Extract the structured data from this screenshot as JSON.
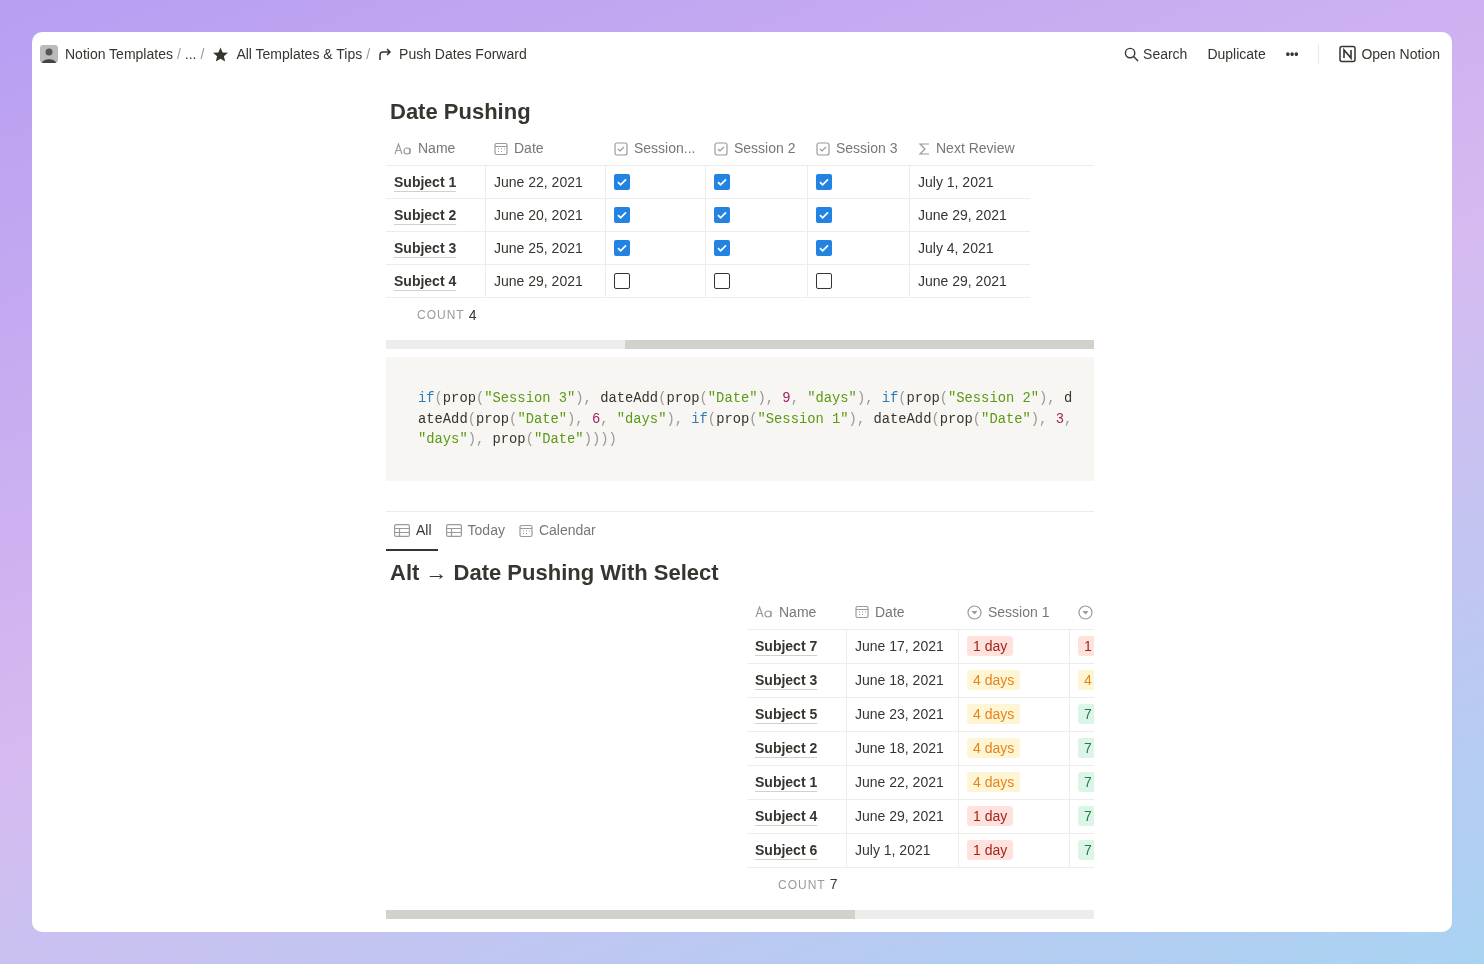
{
  "topbar": {
    "breadcrumbs": [
      {
        "kind": "avatar",
        "label": "Notion Templates"
      },
      {
        "kind": "plain",
        "label": "...",
        "separator": "/"
      },
      {
        "kind": "star",
        "label": "All Templates & Tips",
        "separator": "/"
      },
      {
        "kind": "redirect",
        "label": "Push Dates Forward",
        "separator": "/"
      }
    ],
    "search": "Search",
    "duplicate": "Duplicate",
    "more": "•••",
    "open": "Open Notion"
  },
  "table1": {
    "title": "Date Pushing",
    "columns": [
      {
        "kind": "title",
        "label": "Name"
      },
      {
        "kind": "date",
        "label": "Date"
      },
      {
        "kind": "checkbox",
        "label": "Session..."
      },
      {
        "kind": "checkbox",
        "label": "Session 2"
      },
      {
        "kind": "checkbox",
        "label": "Session 3"
      },
      {
        "kind": "formula",
        "label": "Next Review"
      }
    ],
    "rows": [
      {
        "name": "Subject 1",
        "date": "June 22, 2021",
        "sessions": [
          {
            "checked": true
          },
          {
            "checked": true
          },
          {
            "checked": true
          }
        ],
        "next_review": "July 1, 2021"
      },
      {
        "name": "Subject 2",
        "date": "June 20, 2021",
        "sessions": [
          {
            "checked": true
          },
          {
            "checked": true
          },
          {
            "checked": true
          }
        ],
        "next_review": "June 29, 2021"
      },
      {
        "name": "Subject 3",
        "date": "June 25, 2021",
        "sessions": [
          {
            "checked": true
          },
          {
            "checked": true
          },
          {
            "checked": true
          }
        ],
        "next_review": "July 4, 2021"
      },
      {
        "name": "Subject 4",
        "date": "June 29, 2021",
        "sessions": [
          {
            "checked": false
          },
          {
            "checked": false
          },
          {
            "checked": false
          }
        ],
        "next_review": "June 29, 2021"
      }
    ],
    "count_label": "COUNT",
    "count": "4"
  },
  "code": [
    {
      "kind": "keyword",
      "text": "if"
    },
    {
      "kind": "punct",
      "text": "("
    },
    {
      "kind": "plain",
      "text": "prop"
    },
    {
      "kind": "punct",
      "text": "("
    },
    {
      "kind": "string",
      "text": "\"Session 3\""
    },
    {
      "kind": "punct",
      "text": "), "
    },
    {
      "kind": "plain",
      "text": "dateAdd"
    },
    {
      "kind": "punct",
      "text": "("
    },
    {
      "kind": "plain",
      "text": "prop"
    },
    {
      "kind": "punct",
      "text": "("
    },
    {
      "kind": "string",
      "text": "\"Date\""
    },
    {
      "kind": "punct",
      "text": "), "
    },
    {
      "kind": "number",
      "text": "9"
    },
    {
      "kind": "punct",
      "text": ", "
    },
    {
      "kind": "string",
      "text": "\"days\""
    },
    {
      "kind": "punct",
      "text": "), "
    },
    {
      "kind": "keyword",
      "text": "if"
    },
    {
      "kind": "punct",
      "text": "("
    },
    {
      "kind": "plain",
      "text": "prop"
    },
    {
      "kind": "punct",
      "text": "("
    },
    {
      "kind": "string",
      "text": "\"Session 2\""
    },
    {
      "kind": "punct",
      "text": "), "
    },
    {
      "kind": "plain",
      "text": "dateAdd"
    },
    {
      "kind": "punct",
      "text": "("
    },
    {
      "kind": "plain",
      "text": "prop"
    },
    {
      "kind": "punct",
      "text": "("
    },
    {
      "kind": "string",
      "text": "\"Date\""
    },
    {
      "kind": "punct",
      "text": "), "
    },
    {
      "kind": "number",
      "text": "6"
    },
    {
      "kind": "punct",
      "text": ", "
    },
    {
      "kind": "string",
      "text": "\"days\""
    },
    {
      "kind": "punct",
      "text": "), "
    },
    {
      "kind": "keyword",
      "text": "if"
    },
    {
      "kind": "punct",
      "text": "("
    },
    {
      "kind": "plain",
      "text": "prop"
    },
    {
      "kind": "punct",
      "text": "("
    },
    {
      "kind": "string",
      "text": "\"Session 1\""
    },
    {
      "kind": "punct",
      "text": "), "
    },
    {
      "kind": "plain",
      "text": "dateAdd"
    },
    {
      "kind": "punct",
      "text": "("
    },
    {
      "kind": "plain",
      "text": "prop"
    },
    {
      "kind": "punct",
      "text": "("
    },
    {
      "kind": "string",
      "text": "\"Date\""
    },
    {
      "kind": "punct",
      "text": "), "
    },
    {
      "kind": "number",
      "text": "3"
    },
    {
      "kind": "punct",
      "text": ", "
    },
    {
      "kind": "string",
      "text": "\"days\""
    },
    {
      "kind": "punct",
      "text": "), "
    },
    {
      "kind": "plain",
      "text": "prop"
    },
    {
      "kind": "punct",
      "text": "("
    },
    {
      "kind": "string",
      "text": "\"Date\""
    },
    {
      "kind": "punct",
      "text": "))))"
    }
  ],
  "views": [
    {
      "kind": "table",
      "label": "All",
      "selected": true
    },
    {
      "kind": "table",
      "label": "Today",
      "selected": false
    },
    {
      "kind": "calendar",
      "label": "Calendar",
      "selected": false
    }
  ],
  "table2": {
    "title": "Alt → Date Pushing With Select",
    "columns": [
      {
        "kind": "title",
        "label": "Name"
      },
      {
        "kind": "date",
        "label": "Date"
      },
      {
        "kind": "select",
        "label": "Session 1"
      },
      {
        "kind": "select"
      }
    ],
    "rows": [
      {
        "name": "Subject 7",
        "date": "June 17, 2021",
        "session_1": {
          "text": "1 day",
          "color": "#ffe2dd"
        },
        "column_4": {
          "text": "1",
          "color": "#ffe2dd"
        }
      },
      {
        "name": "Subject 3",
        "date": "June 18, 2021",
        "session_1": {
          "text": "4 days",
          "color": "#fdf5d4"
        },
        "column_4": {
          "text": "4",
          "color": "#fdf5d4"
        }
      },
      {
        "name": "Subject 5",
        "date": "June 23, 2021",
        "session_1": {
          "text": "4 days",
          "color": "#fdf5d4"
        },
        "column_4": {
          "text": "7",
          "color": "#dbf6e9"
        }
      },
      {
        "name": "Subject 2",
        "date": "June 18, 2021",
        "session_1": {
          "text": "4 days",
          "color": "#fdf5d4"
        },
        "column_4": {
          "text": "7",
          "color": "#dbf6e9"
        }
      },
      {
        "name": "Subject 1",
        "date": "June 22, 2021",
        "session_1": {
          "text": "4 days",
          "color": "#fdf5d4"
        },
        "column_4": {
          "text": "7",
          "color": "#dbf6e9"
        }
      },
      {
        "name": "Subject 4",
        "date": "June 29, 2021",
        "session_1": {
          "text": "1 day",
          "color": "#ffe2dd"
        },
        "column_4": {
          "text": "7",
          "color": "#dbf6e9"
        }
      },
      {
        "name": "Subject 6",
        "date": "July 1, 2021",
        "session_1": {
          "text": "1 day",
          "color": "#ffe2dd"
        },
        "column_4": {
          "text": "7",
          "color": "#dbf6e9"
        }
      }
    ],
    "count_label": "COUNT",
    "count": "7"
  }
}
